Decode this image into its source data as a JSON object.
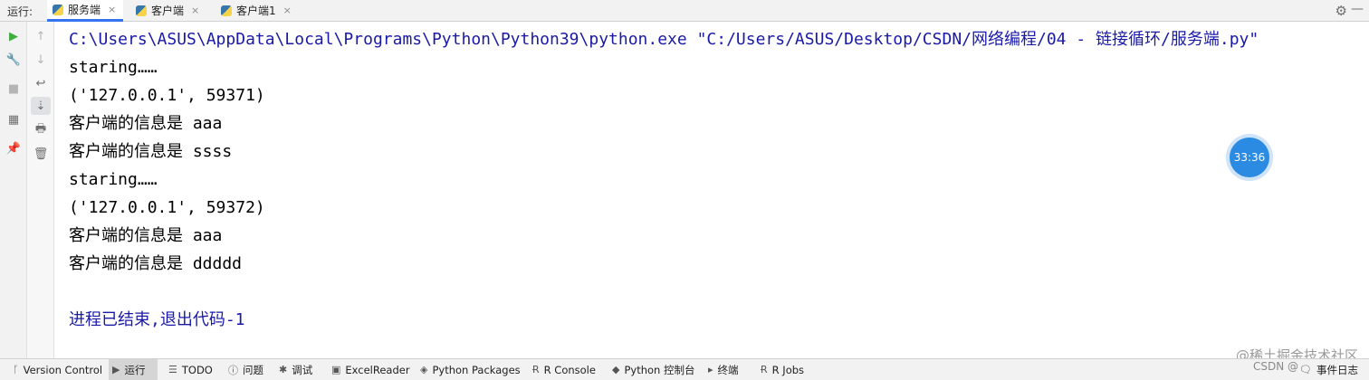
{
  "runbar": {
    "label": "运行:",
    "tabs": [
      {
        "label": "服务端",
        "active": true
      },
      {
        "label": "客户端",
        "active": false
      },
      {
        "label": "客户端1",
        "active": false
      }
    ],
    "close_glyph": "×",
    "settings_icon": "gear-icon",
    "minimize_icon": "minimize-icon"
  },
  "console": {
    "lines": [
      "C:\\Users\\ASUS\\AppData\\Local\\Programs\\Python\\Python39\\python.exe \"C:/Users/ASUS/Desktop/CSDN/网络编程/04 - 链接循环/服务端.py\"",
      "staring……",
      "('127.0.0.1', 59371)",
      "客户端的信息是 aaa",
      "客户端的信息是 ssss",
      "staring……",
      "('127.0.0.1', 59372)",
      "客户端的信息是 aaa",
      "客户端的信息是 ddddd",
      "",
      "进程已结束,退出代码-1"
    ]
  },
  "timer": "33:36",
  "bottombar": {
    "items": [
      {
        "label": "Version Control",
        "icon": "branch-icon"
      },
      {
        "label": "运行",
        "icon": "run-icon",
        "active": true
      },
      {
        "label": "TODO",
        "icon": "list-icon"
      },
      {
        "label": "问题",
        "icon": "info-icon"
      },
      {
        "label": "调试",
        "icon": "bug-icon"
      },
      {
        "label": "ExcelReader",
        "icon": "excel-icon"
      },
      {
        "label": "Python Packages",
        "icon": "layers-icon"
      },
      {
        "label": "R Console",
        "icon": "r-icon"
      },
      {
        "label": "Python 控制台",
        "icon": "python-icon"
      },
      {
        "label": "终端",
        "icon": "terminal-icon"
      },
      {
        "label": "R Jobs",
        "icon": "r-jobs-icon"
      }
    ],
    "event_log": "事件日志"
  },
  "watermark": {
    "line1": "@稀土掘金技术社区",
    "line2": "CSDN @"
  }
}
